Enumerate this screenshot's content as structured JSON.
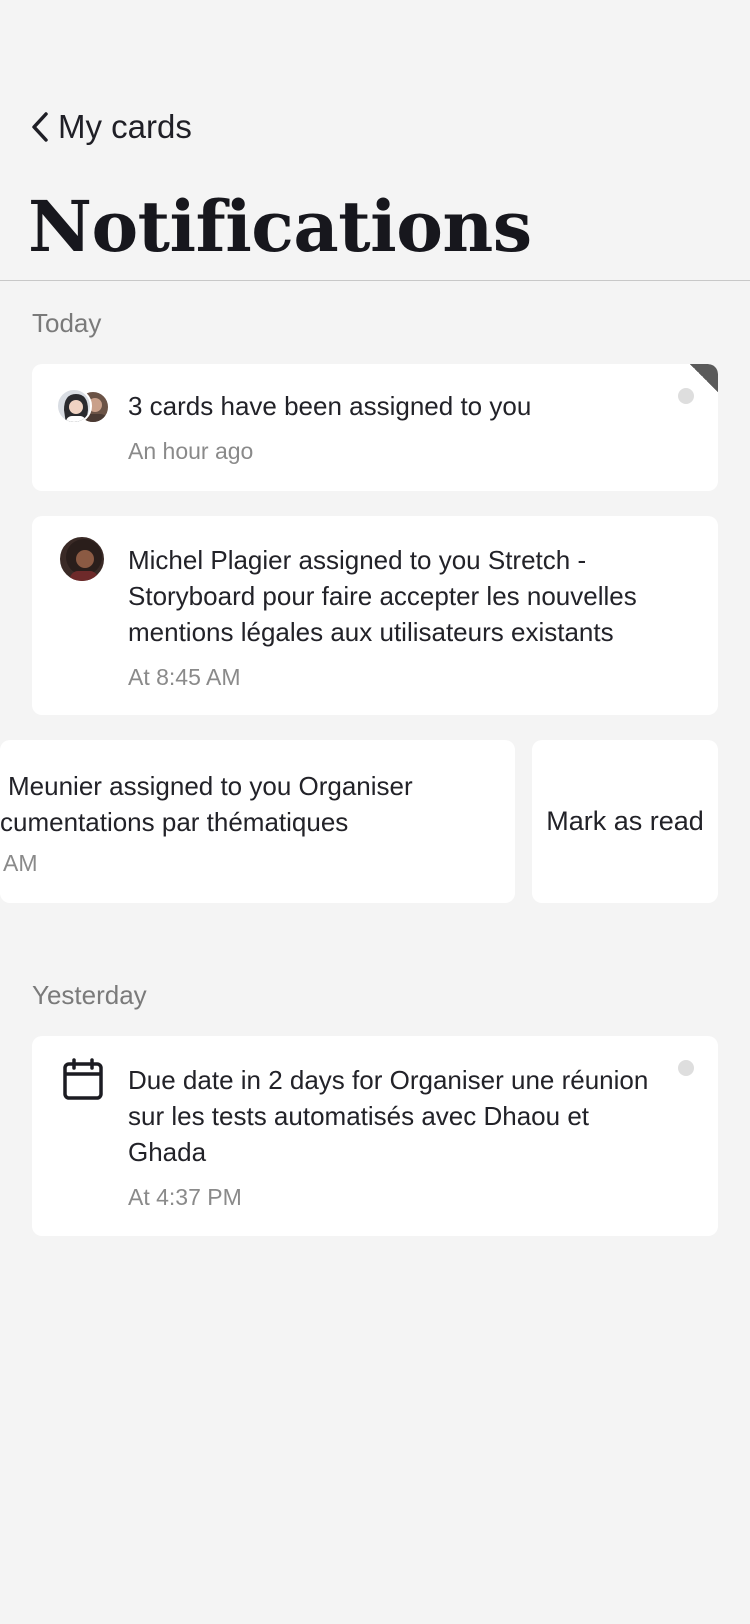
{
  "header": {
    "back_label": "My cards",
    "title": "Notifications"
  },
  "sections": {
    "today_label": "Today",
    "yesterday_label": "Yesterday"
  },
  "notifications": [
    {
      "text": "3 cards have been assigned to you",
      "time": "An hour ago",
      "icon": "group-avatar-icon",
      "unread": true
    },
    {
      "text": "Michel Plagier assigned to you Stretch - Storyboard pour faire accepter les nouvelles mentions légales aux utilisateurs existants",
      "time": "At 8:45 AM",
      "icon": "avatar",
      "unread": false
    },
    {
      "text_line1": "Meunier assigned to you Organiser",
      "text_line2": "cumentations par thématiques",
      "time": "AM",
      "swipe_action": "Mark as read"
    },
    {
      "text": "Due date in 2 days for Organiser une réunion sur les tests automatisés avec Dhaou et Ghada",
      "time": "At 4:37 PM",
      "icon": "calendar-icon",
      "unread": true
    }
  ],
  "colors": {
    "background": "#f4f4f4",
    "card": "#ffffff",
    "muted_text": "#8a8a8a",
    "unread_dot": "#dedede"
  }
}
